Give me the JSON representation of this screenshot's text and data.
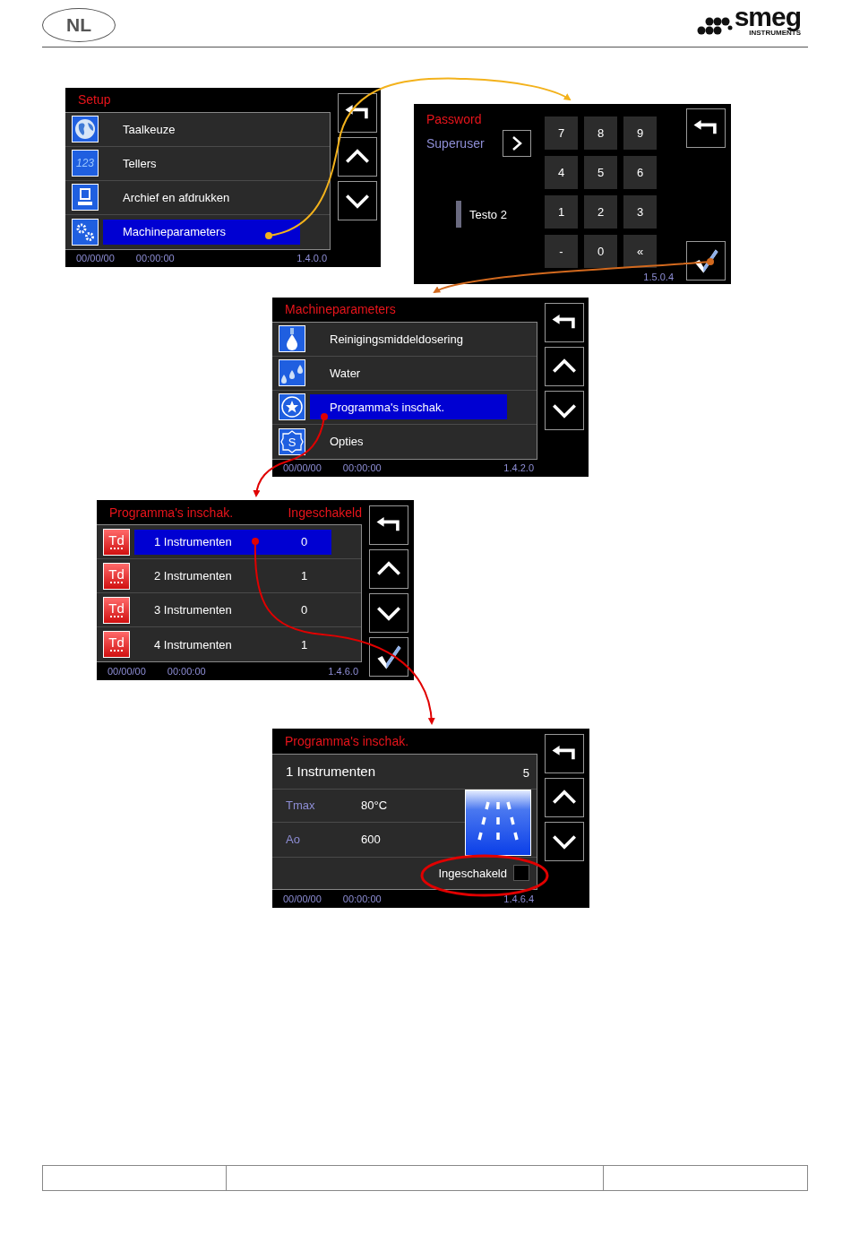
{
  "header": {
    "language": "NL",
    "brand": "smeg",
    "brand_sub": "INSTRUMENTS"
  },
  "screens": [
    {
      "kind": "menu",
      "title": "Setup",
      "items": [
        {
          "label": "Taalkeuze",
          "selected": false
        },
        {
          "label": "Tellers",
          "icon_text": "123",
          "selected": false
        },
        {
          "label": "Archief en afdrukken",
          "selected": false
        },
        {
          "label": "Machineparameters",
          "selected": true
        }
      ],
      "date": "00/00/00",
      "time": "00:00:00",
      "version": "1.4.0.0",
      "buttons": [
        {
          "kind": "back"
        },
        {
          "kind": "up"
        },
        {
          "kind": "down"
        }
      ]
    },
    {
      "kind": "password",
      "title": "Password",
      "user": "Superuser",
      "field": "Testo 2",
      "keys": [
        "7",
        "8",
        "9",
        "4",
        "5",
        "6",
        "1",
        "2",
        "3",
        "-",
        "0",
        "«"
      ],
      "version": "1.5.0.4",
      "buttons": [
        {
          "kind": "back"
        },
        {
          "kind": "confirm"
        }
      ]
    },
    {
      "kind": "menu",
      "title": "Machineparameters",
      "items": [
        {
          "label": "Reinigingsmiddeldosering",
          "selected": false
        },
        {
          "label": "Water",
          "selected": false
        },
        {
          "label": "Programma's inschak.",
          "selected": true
        },
        {
          "label": "Opties",
          "icon_text": "S",
          "selected": false
        }
      ],
      "date": "00/00/00",
      "time": "00:00:00",
      "version": "1.4.2.0",
      "buttons": [
        {
          "kind": "back"
        },
        {
          "kind": "up"
        },
        {
          "kind": "down"
        }
      ]
    },
    {
      "kind": "list",
      "title": "Programma's inschak.",
      "column_header": "Ingeschakeld",
      "items": [
        {
          "icon_text": "Td",
          "label": "1 Instrumenten",
          "value": "0",
          "selected": true
        },
        {
          "icon_text": "Td",
          "label": "2 Instrumenten",
          "value": "1",
          "selected": false
        },
        {
          "icon_text": "Td",
          "label": "3 Instrumenten",
          "value": "0",
          "selected": false
        },
        {
          "icon_text": "Td",
          "label": "4 Instrumenten",
          "value": "1",
          "selected": false
        }
      ],
      "date": "00/00/00",
      "time": "00:00:00",
      "version": "1.4.6.0",
      "buttons": [
        {
          "kind": "back"
        },
        {
          "kind": "up"
        },
        {
          "kind": "down"
        },
        {
          "kind": "confirm"
        }
      ]
    },
    {
      "kind": "detail",
      "title": "Programma's inschak.",
      "name": "1 Instrumenten",
      "number": "5",
      "params": [
        {
          "label": "Tmax",
          "value": "80°C"
        },
        {
          "label": "Ao",
          "value": "600"
        }
      ],
      "checkbox": {
        "label": "Ingeschakeld",
        "checked": false
      },
      "date": "00/00/00",
      "time": "00:00:00",
      "version": "1.4.6.4",
      "buttons": [
        {
          "kind": "back"
        },
        {
          "kind": "up"
        },
        {
          "kind": "down"
        }
      ]
    }
  ]
}
